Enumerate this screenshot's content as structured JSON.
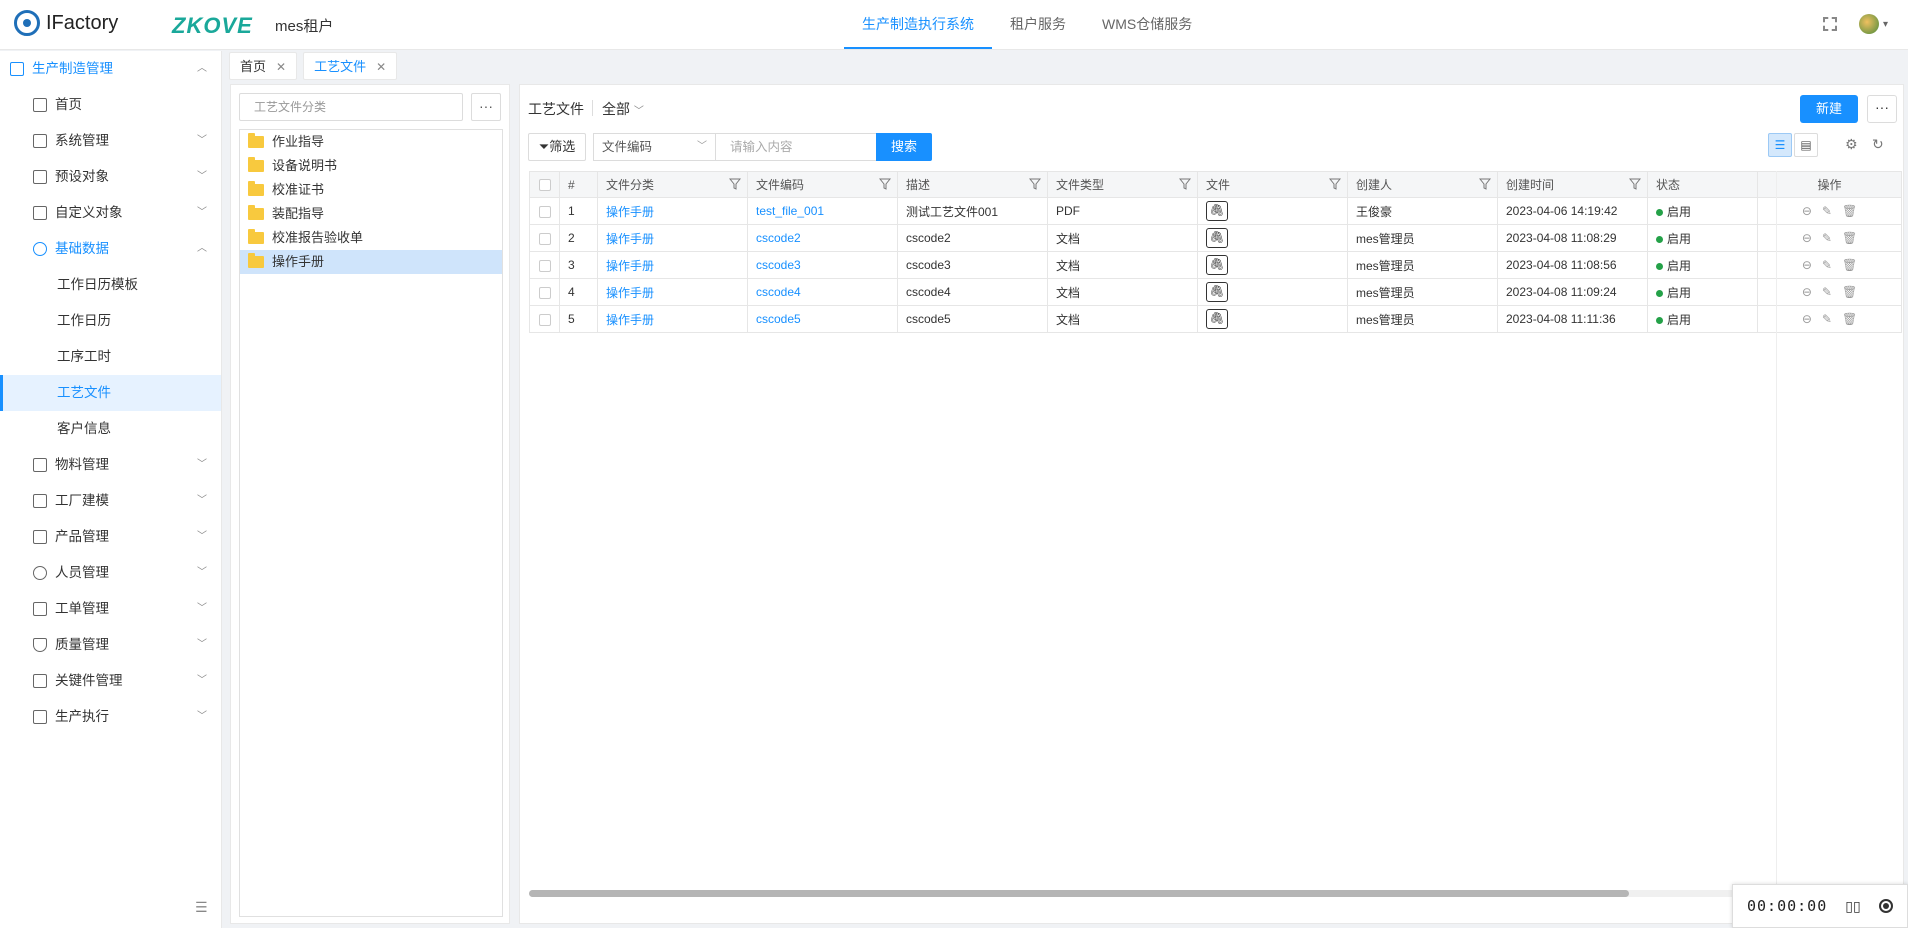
{
  "header": {
    "app_name": "IFactory",
    "brand": "ZKOVE",
    "tenant": "mes租户",
    "nav": [
      "生产制造执行系统",
      "租户服务",
      "WMS仓储服务"
    ],
    "active_nav": "生产制造执行系统"
  },
  "sidebar": {
    "top_group": "生产制造管理",
    "items": [
      {
        "label": "首页",
        "icon": "home-icon"
      },
      {
        "label": "系统管理",
        "icon": "grid-icon"
      },
      {
        "label": "预设对象",
        "icon": "object-icon"
      },
      {
        "label": "自定义对象",
        "icon": "doc-icon"
      },
      {
        "label": "基础数据",
        "icon": "gear-icon"
      }
    ],
    "sub_items": [
      "工作日历模板",
      "工作日历",
      "工序工时",
      "工艺文件",
      "客户信息"
    ],
    "active_sub": "工艺文件",
    "groups": [
      {
        "label": "物料管理",
        "icon": "material-icon"
      },
      {
        "label": "工厂建模",
        "icon": "factory-icon"
      },
      {
        "label": "产品管理",
        "icon": "product-icon"
      },
      {
        "label": "人员管理",
        "icon": "people-icon"
      },
      {
        "label": "工单管理",
        "icon": "order-icon"
      },
      {
        "label": "质量管理",
        "icon": "shield-icon"
      },
      {
        "label": "关键件管理",
        "icon": "key-part-icon"
      },
      {
        "label": "生产执行",
        "icon": "execution-icon"
      }
    ]
  },
  "tabs": [
    {
      "label": "首页"
    },
    {
      "label": "工艺文件"
    }
  ],
  "tree": {
    "search_placeholder": "工艺文件分类",
    "more": "···",
    "nodes": [
      "作业指导",
      "设备说明书",
      "校准证书",
      "装配指导",
      "校准报告验收单",
      "操作手册"
    ],
    "selected": "操作手册"
  },
  "main": {
    "title": "工艺文件",
    "view_filter": "全部",
    "new_button": "新建",
    "more_button": "···",
    "filter_button": "筛选",
    "field_select": "文件编码",
    "keyword_placeholder": "请输入内容",
    "search_button": "搜索"
  },
  "table": {
    "columns": [
      "#",
      "文件分类",
      "文件编码",
      "描述",
      "文件类型",
      "文件",
      "创建人",
      "创建时间",
      "状态",
      "操作"
    ],
    "rows": [
      {
        "no": "1",
        "category": "操作手册",
        "code": "test_file_001",
        "desc": "测试工艺文件001",
        "type": "PDF",
        "creator": "王俊豪",
        "created": "2023-04-06 14:19:42",
        "status": "启用"
      },
      {
        "no": "2",
        "category": "操作手册",
        "code": "cscode2",
        "desc": "cscode2",
        "type": "文档",
        "creator": "mes管理员",
        "created": "2023-04-08 11:08:29",
        "status": "启用"
      },
      {
        "no": "3",
        "category": "操作手册",
        "code": "cscode3",
        "desc": "cscode3",
        "type": "文档",
        "creator": "mes管理员",
        "created": "2023-04-08 11:08:56",
        "status": "启用"
      },
      {
        "no": "4",
        "category": "操作手册",
        "code": "cscode4",
        "desc": "cscode4",
        "type": "文档",
        "creator": "mes管理员",
        "created": "2023-04-08 11:09:24",
        "status": "启用"
      },
      {
        "no": "5",
        "category": "操作手册",
        "code": "cscode5",
        "desc": "cscode5",
        "type": "文档",
        "creator": "mes管理员",
        "created": "2023-04-08 11:11:36",
        "status": "启用"
      }
    ],
    "status_color": "#24a148"
  },
  "recorder": {
    "time": "00:00:00"
  },
  "colors": {
    "accent": "#1890ff",
    "brand": "#1aa89a",
    "folder": "#f8c93e"
  }
}
